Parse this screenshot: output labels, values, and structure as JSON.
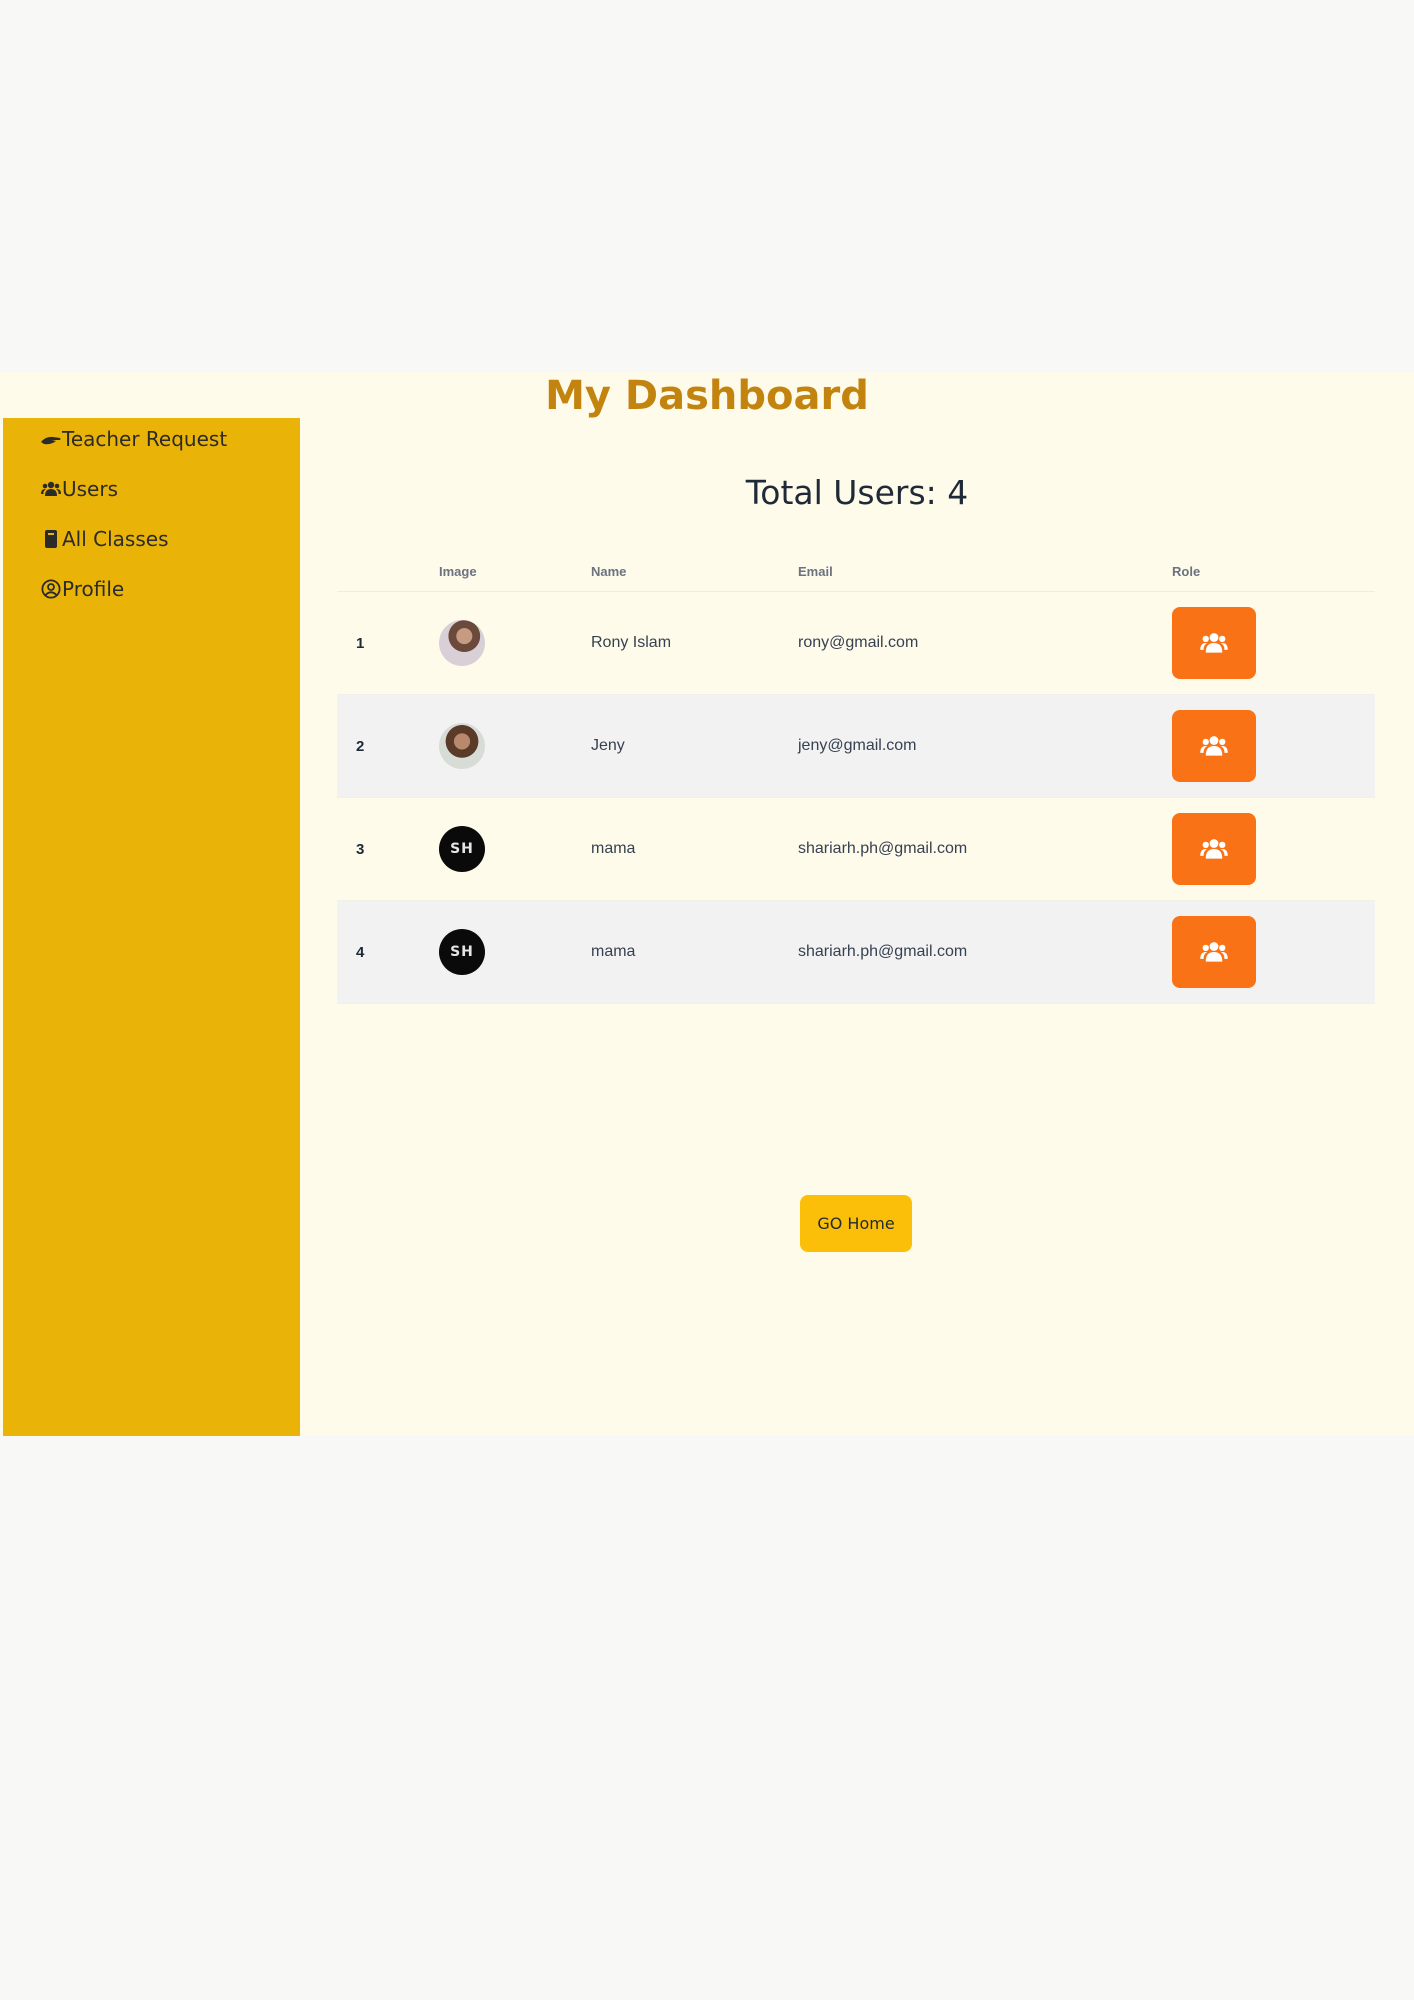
{
  "header": {
    "title": "My Dashboard"
  },
  "sidebar": {
    "items": [
      {
        "label": "Teacher Request",
        "icon": "hand-icon"
      },
      {
        "label": "Users",
        "icon": "users-icon"
      },
      {
        "label": "All Classes",
        "icon": "book-icon"
      },
      {
        "label": "Profile",
        "icon": "user-circle-icon"
      }
    ]
  },
  "main": {
    "title": "Total Users: 4",
    "table": {
      "headers": {
        "index": "",
        "image": "Image",
        "name": "Name",
        "email": "Email",
        "role": "Role"
      },
      "rows": [
        {
          "index": "1",
          "name": "Rony Islam",
          "email": "rony@gmail.com",
          "avatar": "photo"
        },
        {
          "index": "2",
          "name": "Jeny",
          "email": "jeny@gmail.com",
          "avatar": "photo"
        },
        {
          "index": "3",
          "name": "mama",
          "email": "shariarh.ph@gmail.com",
          "avatar": "logo",
          "avatar_text": "SH"
        },
        {
          "index": "4",
          "name": "mama",
          "email": "shariarh.ph@gmail.com",
          "avatar": "logo",
          "avatar_text": "SH"
        }
      ],
      "role_button_icon": "users-icon"
    },
    "home_button": "GO Home"
  },
  "colors": {
    "title": "#c3840f",
    "sidebar": "#e9b308",
    "role_button": "#f97316",
    "home_button": "#fbbf0a",
    "background": "#fefbea"
  }
}
